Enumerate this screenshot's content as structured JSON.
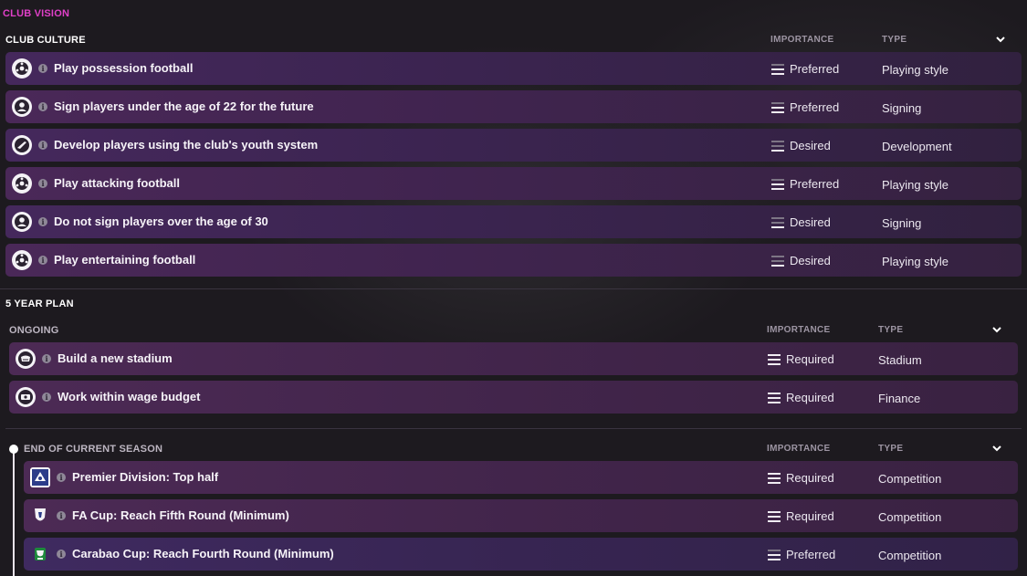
{
  "header": {
    "title": "CLUB VISION"
  },
  "club_culture": {
    "title": "CLUB CULTURE",
    "col_importance": "IMPORTANCE",
    "col_type": "TYPE",
    "rows": [
      {
        "icon": "football-icon",
        "label": "Play possession football",
        "importance": "Preferred",
        "type": "Playing style"
      },
      {
        "icon": "person-icon",
        "label": "Sign players under the age of 22 for the future",
        "importance": "Preferred",
        "type": "Signing"
      },
      {
        "icon": "boot-icon",
        "label": "Develop players using the club's youth system",
        "importance": "Desired",
        "type": "Development"
      },
      {
        "icon": "football-icon",
        "label": "Play attacking football",
        "importance": "Preferred",
        "type": "Playing style"
      },
      {
        "icon": "person-icon",
        "label": "Do not sign players over the age of 30",
        "importance": "Desired",
        "type": "Signing"
      },
      {
        "icon": "football-icon",
        "label": "Play entertaining football",
        "importance": "Desired",
        "type": "Playing style"
      }
    ]
  },
  "five_year_plan": {
    "title": "5 YEAR PLAN",
    "ongoing": {
      "title": "ONGOING",
      "col_importance": "IMPORTANCE",
      "col_type": "TYPE",
      "rows": [
        {
          "icon": "stadium-icon",
          "label": "Build a new stadium",
          "importance": "Required",
          "type": "Stadium"
        },
        {
          "icon": "money-icon",
          "label": "Work within wage budget",
          "importance": "Required",
          "type": "Finance"
        }
      ]
    },
    "end_of_season": {
      "title": "END OF CURRENT SEASON",
      "col_importance": "IMPORTANCE",
      "col_type": "TYPE",
      "rows": [
        {
          "icon": "premier-division-logo-icon",
          "label": "Premier Division: Top half",
          "importance": "Required",
          "type": "Competition"
        },
        {
          "icon": "fa-cup-logo-icon",
          "label": "FA Cup: Reach Fifth Round (Minimum)",
          "importance": "Required",
          "type": "Competition"
        },
        {
          "icon": "carabao-cup-logo-icon",
          "label": "Carabao Cup: Reach Fourth Round (Minimum)",
          "importance": "Preferred",
          "type": "Competition"
        }
      ]
    }
  },
  "colors": {
    "accent": "#e040c8",
    "row": "#3e2554",
    "background": "#1d1a1f"
  },
  "info_glyph": "i"
}
